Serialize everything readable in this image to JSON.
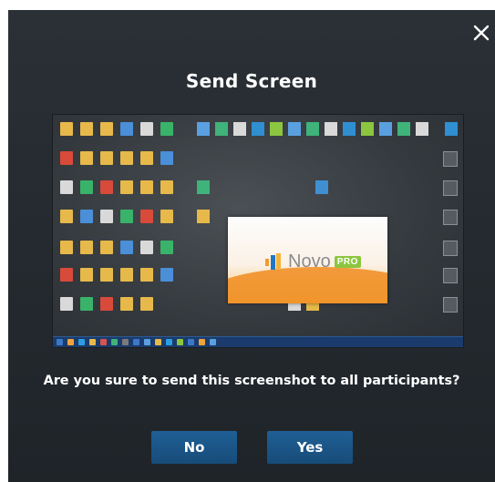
{
  "dialog": {
    "title": "Send Screen",
    "question": "Are you sure to send this screenshot to all participants?",
    "close_icon": "close-icon",
    "buttons": {
      "no_label": "No",
      "yes_label": "Yes"
    },
    "colors": {
      "background": "#262b30",
      "button": "#1b5686",
      "text": "#ffffff"
    }
  },
  "preview": {
    "splash": {
      "brand_name": "Novo",
      "badge": "PRO",
      "colors": {
        "accent": "#f39c2b",
        "badge": "#8cc63f"
      }
    }
  }
}
